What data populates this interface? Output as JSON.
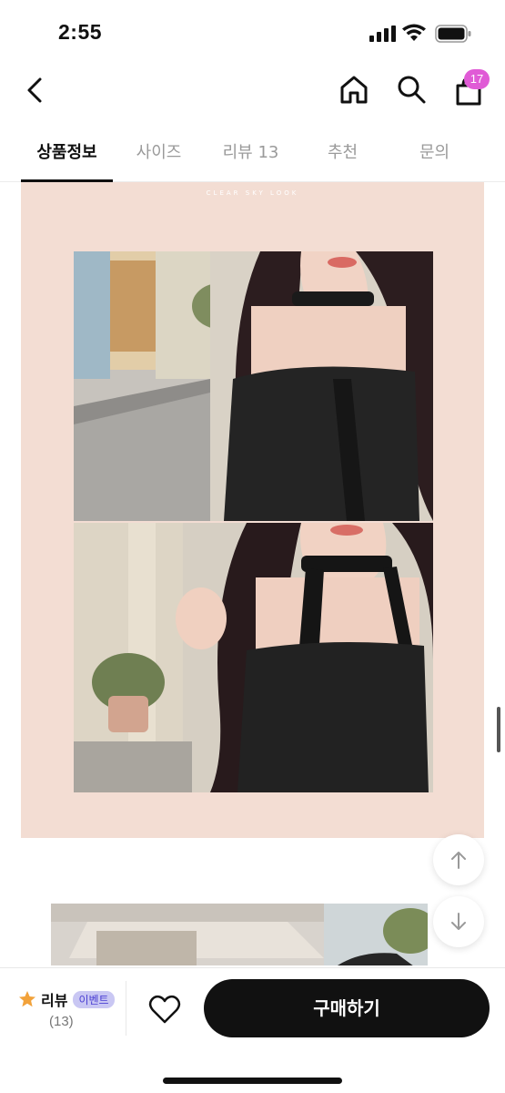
{
  "status_bar": {
    "time": "2:55"
  },
  "nav": {
    "cart_count": "17"
  },
  "tabs": [
    {
      "label": "상품정보",
      "active": true
    },
    {
      "label": "사이즈",
      "active": false
    },
    {
      "label": "리뷰 13",
      "active": false
    },
    {
      "label": "추천",
      "active": false
    },
    {
      "label": "문의",
      "active": false
    }
  ],
  "content": {
    "caption": "CLEAR SKY LOOK"
  },
  "bottom_bar": {
    "review_label": "리뷰",
    "event_badge": "이벤트",
    "review_count": "(13)",
    "buy_label": "구매하기"
  },
  "colors": {
    "panel_bg": "#f3ddd3",
    "badge": "#e05bd6",
    "event_bg": "#c9c7f3",
    "event_text": "#4b3fd3",
    "buy_bg": "#111111",
    "star": "#f2a23a"
  }
}
